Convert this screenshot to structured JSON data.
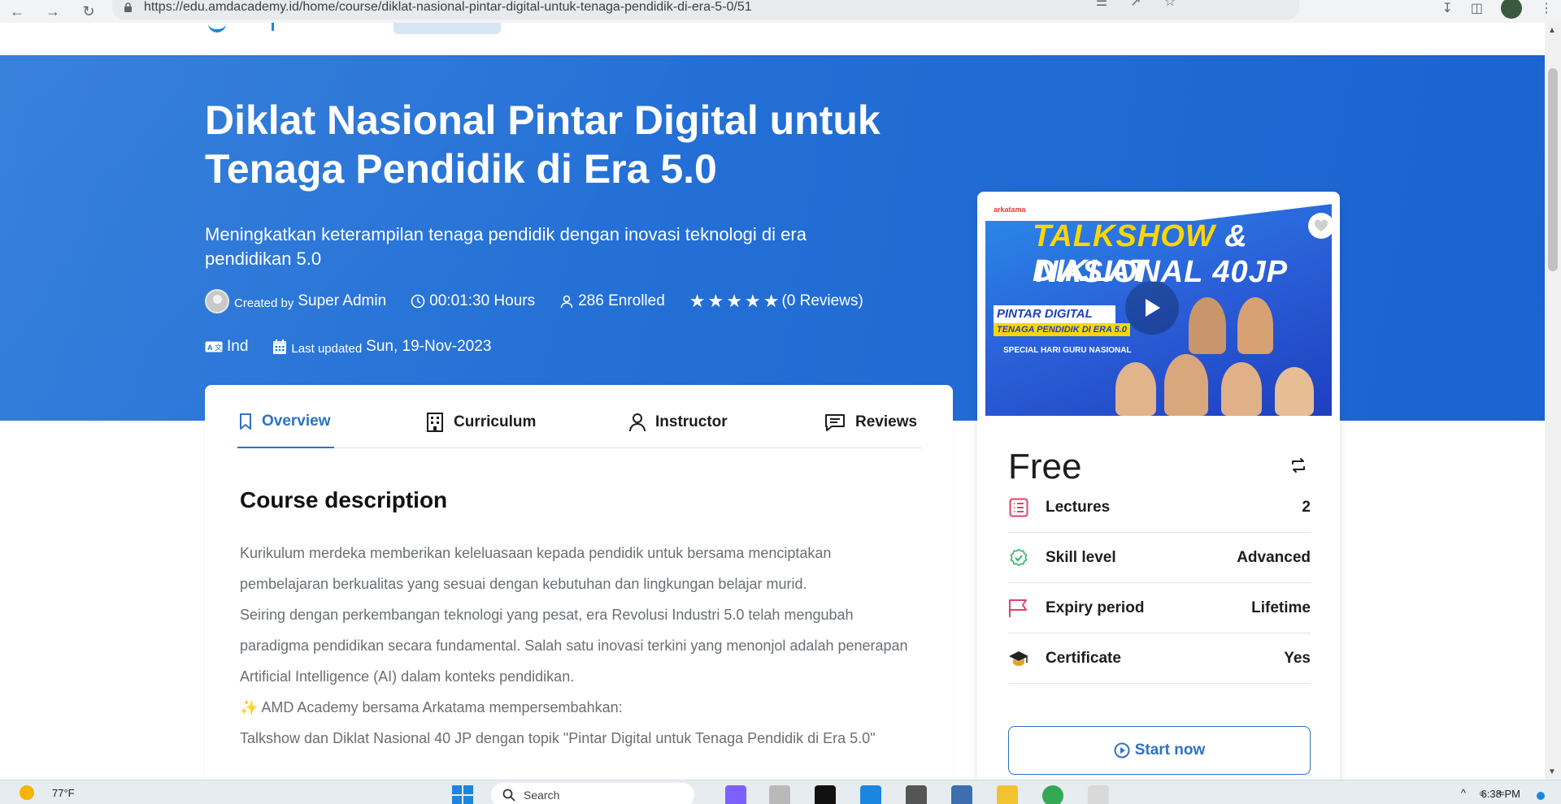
{
  "browser": {
    "url": "https://edu.amdacademy.id/home/course/diklat-nasional-pintar-digital-untuk-tenaga-pendidik-di-era-5-0/51"
  },
  "course": {
    "title": "Diklat Nasional Pintar Digital untuk Tenaga Pendidik di Era 5.0",
    "subtitle": "Meningkatkan keterampilan tenaga pendidik dengan inovasi teknologi di era pendidikan 5.0",
    "created_by_label": "Created by",
    "creator": "Super Admin",
    "duration": "00:01:30 Hours",
    "enrolled": "286 Enrolled",
    "rating_stars": 5,
    "reviews": "(0 Reviews)",
    "language": "Ind",
    "last_updated_label": "Last updated",
    "last_updated": "Sun, 19-Nov-2023"
  },
  "tabs": [
    {
      "label": "Overview",
      "active": true
    },
    {
      "label": "Curriculum",
      "active": false
    },
    {
      "label": "Instructor",
      "active": false
    },
    {
      "label": "Reviews",
      "active": false
    }
  ],
  "description": {
    "heading": "Course description",
    "paragraphs": [
      "Kurikulum merdeka memberikan keleluasaan kepada pendidik untuk bersama menciptakan pembelajaran berkualitas yang sesuai dengan kebutuhan dan lingkungan belajar murid.",
      "Seiring dengan perkembangan teknologi yang pesat, era Revolusi Industri 5.0 telah mengubah paradigma pendidikan secara fundamental. Salah satu inovasi terkini yang menonjol adalah penerapan Artificial Intelligence (AI) dalam konteks pendidikan.",
      "✨ AMD Academy bersama Arkatama mempersembahkan:",
      "Talkshow dan Diklat Nasional 40 JP dengan topik \"Pintar Digital untuk Tenaga Pendidik di Era 5.0\""
    ]
  },
  "thumbnail": {
    "brand": "arkatama",
    "line1_a": "TALKSHOW",
    "line1_b": " & DIKLAT",
    "line2": "NASIONAL 40JP",
    "tag1": "PINTAR DIGITAL",
    "tag2": "TENAGA PENDIDIK DI ERA 5.0",
    "tag3": "SPECIAL HARI GURU NASIONAL"
  },
  "sidebar": {
    "price": "Free",
    "rows": [
      {
        "label": "Lectures",
        "value": "2"
      },
      {
        "label": "Skill level",
        "value": "Advanced"
      },
      {
        "label": "Expiry period",
        "value": "Lifetime"
      },
      {
        "label": "Certificate",
        "value": "Yes"
      }
    ],
    "start_label": "Start now"
  },
  "taskbar": {
    "temperature": "77°F",
    "search_placeholder": "Search",
    "time": "6:38 PM"
  },
  "colors": {
    "hero_blue": "#2470d6",
    "accent": "#2d72c6",
    "lectures_icon": "#e83e6b",
    "skill_icon": "#2fb36a",
    "expiry_icon": "#e83e6b"
  }
}
